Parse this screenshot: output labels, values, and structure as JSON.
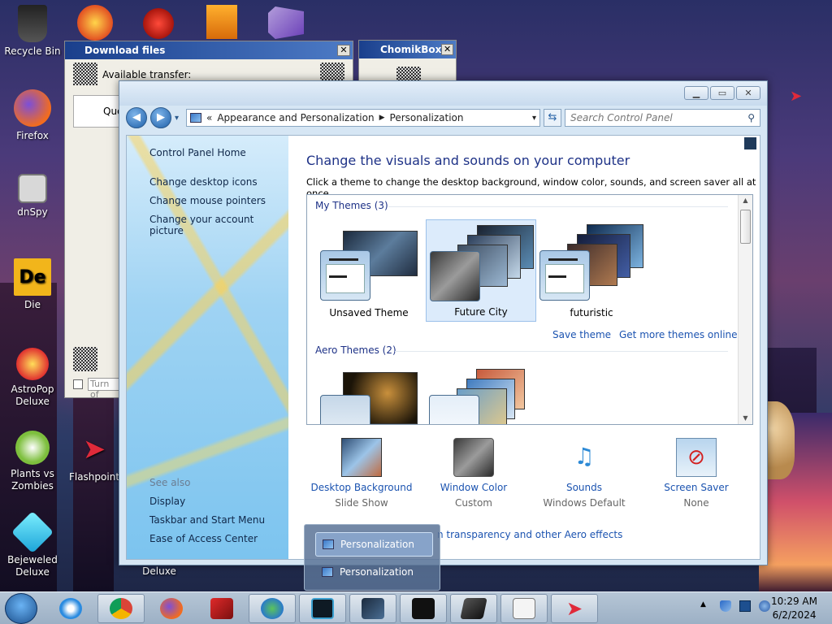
{
  "desktop": {
    "icons": [
      {
        "label": "Recycle Bin"
      },
      {
        "label": "Firefox"
      },
      {
        "label": "dnSpy"
      },
      {
        "label": "Die"
      },
      {
        "label": "AstroPop Deluxe"
      },
      {
        "label": "Plants vs Zombies"
      },
      {
        "label": "Flashpoint"
      },
      {
        "label": "Bejeweled Deluxe"
      },
      {
        "label": "Deluxe"
      }
    ]
  },
  "download_window": {
    "title": "Download files",
    "available_label": "Available transfer:",
    "queue_label": "Que",
    "turn_off_label": "Turn of"
  },
  "chomik_window": {
    "title": "ChomikBox"
  },
  "control_panel": {
    "breadcrumb_prefix": "«",
    "breadcrumb": [
      "Appearance and Personalization",
      "Personalization"
    ],
    "search_placeholder": "Search Control Panel",
    "sidebar": {
      "home": "Control Panel Home",
      "links": [
        "Change desktop icons",
        "Change mouse pointers",
        "Change your account picture"
      ],
      "see_also_label": "See also",
      "see_also": [
        "Display",
        "Taskbar and Start Menu",
        "Ease of Access Center"
      ]
    },
    "heading": "Change the visuals and sounds on your computer",
    "subheading": "Click a theme to change the desktop background, window color, sounds, and screen saver all at once.",
    "my_themes_label": "My Themes (3)",
    "my_themes": [
      {
        "name": "Unsaved Theme"
      },
      {
        "name": "Future City",
        "selected": true
      },
      {
        "name": "futuristic"
      }
    ],
    "save_theme": "Save theme",
    "more_themes": "Get more themes online",
    "aero_themes_label": "Aero Themes (2)",
    "bottom": [
      {
        "name": "Desktop Background",
        "value": "Slide Show"
      },
      {
        "name": "Window Color",
        "value": "Custom"
      },
      {
        "name": "Sounds",
        "value": "Windows Default"
      },
      {
        "name": "Screen Saver",
        "value": "None"
      }
    ],
    "aero_link_partial": "n transparency and other Aero effects"
  },
  "taskbar_popup": {
    "items": [
      "Personalization",
      "Personalization"
    ]
  },
  "taskbar": {
    "time": "10:29 AM",
    "date": "6/2/2024"
  }
}
